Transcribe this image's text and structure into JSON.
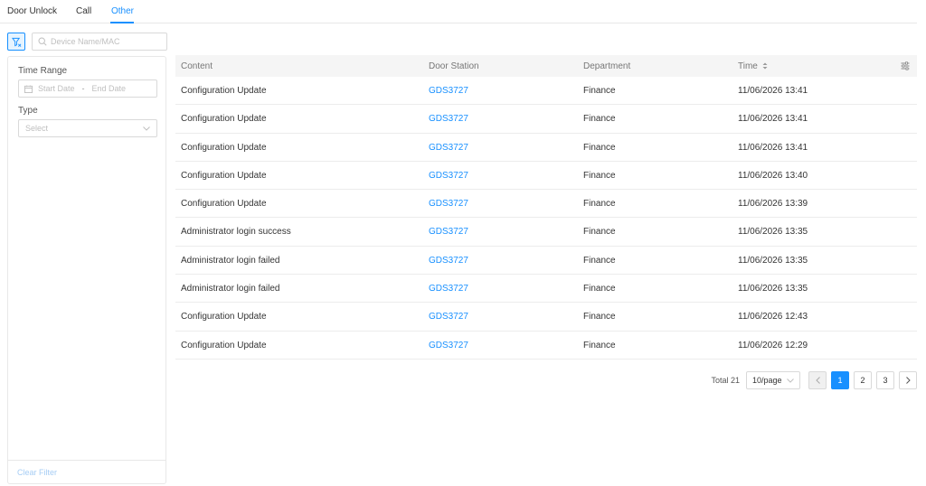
{
  "tabs": [
    {
      "label": "Door Unlock",
      "active": false
    },
    {
      "label": "Call",
      "active": false
    },
    {
      "label": "Other",
      "active": true
    }
  ],
  "search": {
    "placeholder": "Device Name/MAC",
    "value": ""
  },
  "filter_panel": {
    "time_range_label": "Time Range",
    "start_placeholder": "Start Date",
    "range_separator": "-",
    "end_placeholder": "End Date",
    "type_label": "Type",
    "type_placeholder": "Select",
    "clear_label": "Clear Filter"
  },
  "table": {
    "columns": [
      "Content",
      "Door Station",
      "Department",
      "Time"
    ],
    "rows": [
      {
        "content": "Configuration Update",
        "door_station": "GDS3727",
        "department": "Finance",
        "time": "11/06/2026 13:41"
      },
      {
        "content": "Configuration Update",
        "door_station": "GDS3727",
        "department": "Finance",
        "time": "11/06/2026 13:41"
      },
      {
        "content": "Configuration Update",
        "door_station": "GDS3727",
        "department": "Finance",
        "time": "11/06/2026 13:41"
      },
      {
        "content": "Configuration Update",
        "door_station": "GDS3727",
        "department": "Finance",
        "time": "11/06/2026 13:40"
      },
      {
        "content": "Configuration Update",
        "door_station": "GDS3727",
        "department": "Finance",
        "time": "11/06/2026 13:39"
      },
      {
        "content": "Administrator login success",
        "door_station": "GDS3727",
        "department": "Finance",
        "time": "11/06/2026 13:35"
      },
      {
        "content": "Administrator login failed",
        "door_station": "GDS3727",
        "department": "Finance",
        "time": "11/06/2026 13:35"
      },
      {
        "content": "Administrator login failed",
        "door_station": "GDS3727",
        "department": "Finance",
        "time": "11/06/2026 13:35"
      },
      {
        "content": "Configuration Update",
        "door_station": "GDS3727",
        "department": "Finance",
        "time": "11/06/2026 12:43"
      },
      {
        "content": "Configuration Update",
        "door_station": "GDS3727",
        "department": "Finance",
        "time": "11/06/2026 12:29"
      }
    ]
  },
  "pagination": {
    "total_label": "Total 21",
    "page_size": "10/page",
    "pages": [
      "1",
      "2",
      "3"
    ],
    "current_page": "1"
  },
  "colors": {
    "accent": "#1890ff",
    "link": "#1890ff",
    "header_bg": "#f5f5f5"
  },
  "icons": {
    "filter_toggle": "filter-icon",
    "search": "search-icon",
    "calendar": "calendar-icon",
    "select_arrow": "chevron-down-icon",
    "sort": "sort-icon",
    "settings": "column-settings-icon",
    "prev": "chevron-left-icon",
    "next": "chevron-right-icon"
  }
}
